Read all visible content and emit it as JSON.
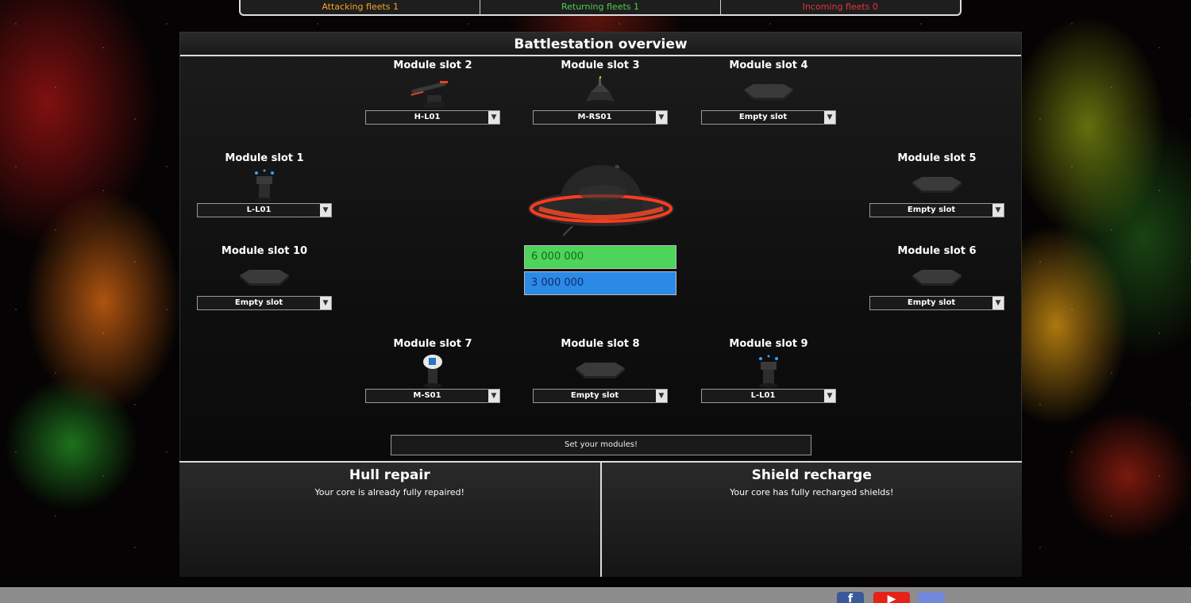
{
  "fleets": {
    "attacking": "Attacking fleets 1",
    "returning": "Returning fleets 1",
    "incoming": "Incoming fleets 0"
  },
  "overview": {
    "title": "Battlestation overview",
    "slots": [
      {
        "label": "Module slot 1",
        "value": "L-L01",
        "icon": "laser-turret-icon"
      },
      {
        "label": "Module slot 2",
        "value": "H-L01",
        "icon": "heavy-laser-icon"
      },
      {
        "label": "Module slot 3",
        "value": "M-RS01",
        "icon": "rocket-silo-icon"
      },
      {
        "label": "Module slot 4",
        "value": "Empty slot",
        "icon": "empty-slot-icon"
      },
      {
        "label": "Module slot 5",
        "value": "Empty slot",
        "icon": "empty-slot-icon"
      },
      {
        "label": "Module slot 6",
        "value": "Empty slot",
        "icon": "empty-slot-icon"
      },
      {
        "label": "Module slot 7",
        "value": "M-S01",
        "icon": "shield-module-icon"
      },
      {
        "label": "Module slot 8",
        "value": "Empty slot",
        "icon": "empty-slot-icon"
      },
      {
        "label": "Module slot 9",
        "value": "L-L01",
        "icon": "laser-turret-icon"
      },
      {
        "label": "Module slot 10",
        "value": "Empty slot",
        "icon": "empty-slot-icon"
      }
    ],
    "hull_value": "6 000 000",
    "shield_value": "3 000 000",
    "set_button": "Set your modules!"
  },
  "repair": {
    "hull_title": "Hull repair",
    "hull_text": "Your core is already fully repaired!",
    "shield_title": "Shield recharge",
    "shield_text": "Your core has fully recharged shields!"
  },
  "social": {
    "facebook": "f",
    "youtube": "▶",
    "discord": ""
  },
  "colors": {
    "attacking": "#f5a623",
    "returning": "#4ecf4e",
    "incoming": "#e8333a",
    "hull": "#4ed45a",
    "shield": "#2b8ae6"
  }
}
